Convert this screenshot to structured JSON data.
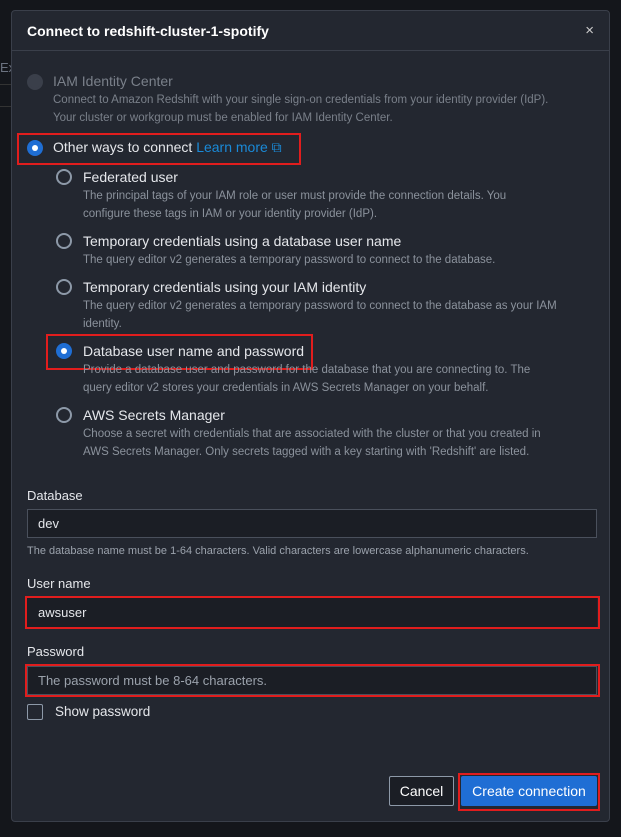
{
  "background": {
    "tab_fragment": "Ex"
  },
  "dialog": {
    "title": "Connect to redshift-cluster-1-spotify",
    "close_icon": "×",
    "options": {
      "iam_identity_center": {
        "label": "IAM Identity Center",
        "desc1": "Connect to Amazon Redshift with your single sign-on credentials from your identity provider (IdP).",
        "desc2": "Your cluster or workgroup must be enabled for IAM Identity Center.",
        "disabled": true
      },
      "other_ways": {
        "label": "Other ways to connect",
        "link": "Learn more",
        "selected": true
      },
      "sub": [
        {
          "label": "Federated user",
          "desc1": "The principal tags of your IAM role or user must provide the connection details. You",
          "desc2": "configure these tags in IAM or your identity provider (IdP)."
        },
        {
          "label": "Temporary credentials using a database user name",
          "desc1": "The query editor v2 generates a temporary password to connect to the database.",
          "desc2": ""
        },
        {
          "label": "Temporary credentials using your IAM identity",
          "desc1": "The query editor v2 generates a temporary password to connect to the database as your IAM",
          "desc2": "identity."
        },
        {
          "label": "Database user name and password",
          "desc1": "Provide a database user and password for the database that you are connecting to. The",
          "desc2": "query editor v2 stores your credentials in AWS Secrets Manager on your behalf.",
          "selected": true
        },
        {
          "label": "AWS Secrets Manager",
          "desc1": "Choose a secret with credentials that are associated with the cluster or that you created in",
          "desc2": "AWS Secrets Manager. Only secrets tagged with a key starting with 'Redshift' are listed."
        }
      ]
    },
    "database": {
      "label": "Database",
      "value": "dev",
      "hint": "The database name must be 1-64 characters. Valid characters are lowercase alphanumeric characters."
    },
    "username": {
      "label": "User name",
      "value": "awsuser"
    },
    "password": {
      "label": "Password",
      "value": "",
      "placeholder": "The password must be 8-64 characters."
    },
    "show_password": {
      "label": "Show password",
      "checked": false
    },
    "cancel": "Cancel",
    "create": "Create connection",
    "colors": {
      "primary": "#1f6ed4",
      "highlight": "#e11d1d",
      "link": "#1a8ad8"
    }
  }
}
